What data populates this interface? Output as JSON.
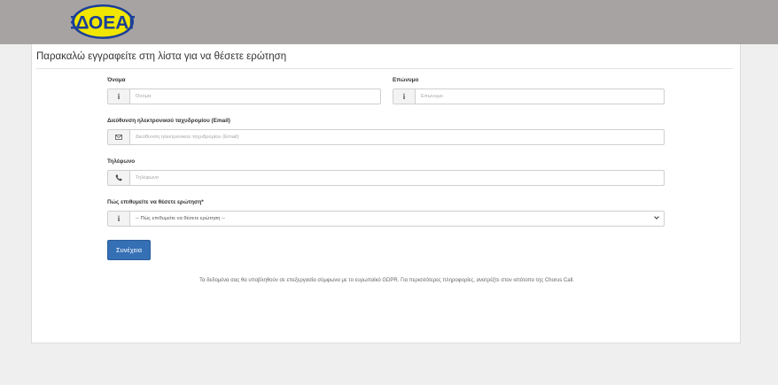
{
  "header": {
    "logo_text": "ΕΔΟΕΑΠ",
    "logo_color": "#1b3f98",
    "logo_fill": "#f1e600"
  },
  "form": {
    "title": "Παρακαλώ εγγραφείτε στη λίστα για να θέσετε ερώτηση",
    "first_name": {
      "label": "Όνομα",
      "placeholder": "Όνομα",
      "icon": "info-icon"
    },
    "last_name": {
      "label": "Επώνυμο",
      "placeholder": "Επώνυμο",
      "icon": "info-icon"
    },
    "email": {
      "label": "Διεύθυνση ηλεκτρονικού ταχυδρομίου (Email)",
      "placeholder": "Διεύθυνση ηλεκτρονικού ταχυδρομίου (Email)",
      "icon": "envelope-icon"
    },
    "phone": {
      "label": "Τηλέφωνο",
      "placeholder": "Τηλέφωνο",
      "icon": "phone-icon"
    },
    "question_mode": {
      "label": "Πώς επιθυμείτε να θέσετε ερώτηση*",
      "selected": "-- Πώς επιθυμείτε να θέσετε ερώτηση --",
      "icon": "info-icon"
    },
    "submit_label": "Συνέχεια",
    "gdpr_text": "Τα δεδομένα σας θα υποβληθούν σε επεξεργασία σύμφωνα με το ευρωπαϊκό GDPR. Για περισσότερες πληροφορίες, ανατρέξτε στον ιστότοπο της Chorus Call."
  }
}
